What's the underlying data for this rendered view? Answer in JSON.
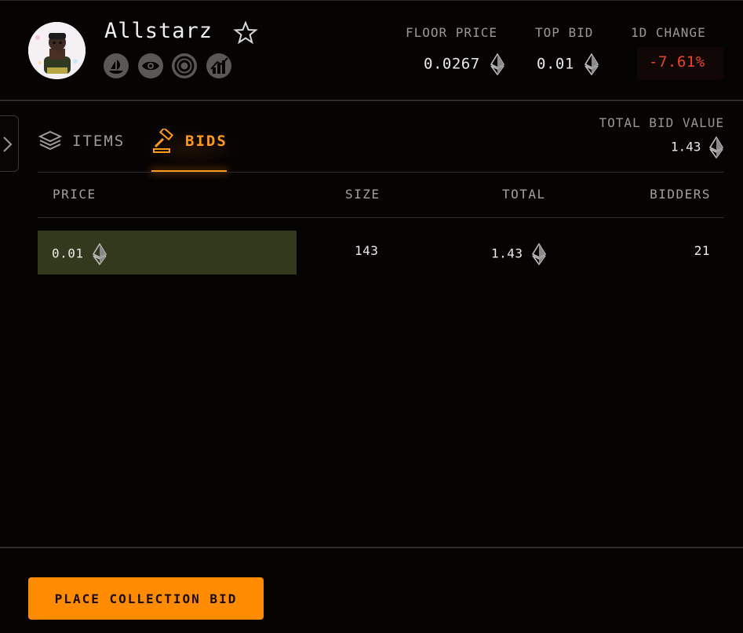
{
  "collection": {
    "name": "Allstarz"
  },
  "stats": {
    "floor_price_label": "FLOOR PRICE",
    "floor_price_value": "0.0267",
    "top_bid_label": "TOP BID",
    "top_bid_value": "0.01",
    "change_label": "1D CHANGE",
    "change_value": "-7.61%"
  },
  "tabs": {
    "items_label": "ITEMS",
    "bids_label": "BIDS",
    "active": "BIDS"
  },
  "total_bid": {
    "label": "TOTAL BID VALUE",
    "value": "1.43"
  },
  "table": {
    "headers": {
      "price": "PRICE",
      "size": "SIZE",
      "total": "TOTAL",
      "bidders": "BIDDERS"
    },
    "rows": [
      {
        "price": "0.01",
        "size": "143",
        "total": "1.43",
        "bidders": "21"
      }
    ]
  },
  "footer": {
    "place_bid_label": "PLACE COLLECTION BID"
  },
  "icons": {
    "star": "star-icon",
    "socials": [
      "opensea-icon",
      "eye-icon",
      "target-icon",
      "chart-icon"
    ],
    "eth": "eth-icon",
    "items": "layers-icon",
    "bids": "gavel-icon",
    "toggle": "chevron-right-icon"
  },
  "colors": {
    "accent": "#ff8c00",
    "negative": "#e8452a",
    "bid_bar": "#33391c",
    "background": "#060303"
  }
}
